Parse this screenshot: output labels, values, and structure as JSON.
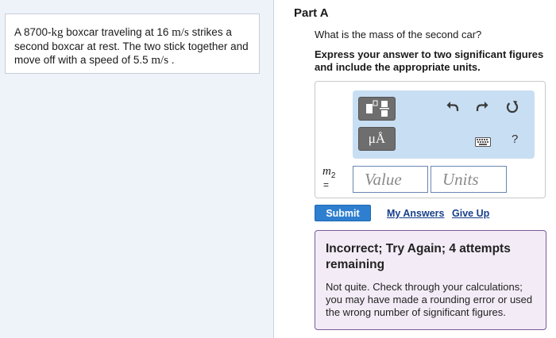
{
  "problem": {
    "text_1": "A 8700-",
    "mass_unit": "kg",
    "text_2": " boxcar traveling at 16 ",
    "speed_unit_1": "m/s",
    "text_3": " strikes a second boxcar at rest. The two stick together and move off with a speed of 5.5 ",
    "speed_unit_2": "m/s",
    "text_4": " ."
  },
  "part": {
    "title": "Part A",
    "question": "What is the mass of the second car?",
    "instruction": "Express your answer to two significant figures and include the appropriate units."
  },
  "toolbar": {
    "templates_icon": "templates-icon",
    "units_label": "μÅ",
    "undo_icon": "undo-icon",
    "redo_icon": "redo-icon",
    "reset_icon": "reset-icon",
    "keyboard_icon": "keyboard-icon",
    "help_label": "?"
  },
  "answer": {
    "variable": "m",
    "subscript": "2",
    "equals": "=",
    "value_placeholder": "Value",
    "units_placeholder": "Units"
  },
  "actions": {
    "submit_label": "Submit",
    "my_answers_label": "My Answers",
    "give_up_label": "Give Up"
  },
  "feedback": {
    "title": "Incorrect; Try Again; 4 attempts remaining",
    "text": "Not quite. Check through your calculations; you may have made a rounding error or used the wrong number of significant figures."
  },
  "colors": {
    "left_pane_bg": "#eef3fa",
    "toolbar_bg": "#c8def3",
    "submit_bg": "#2e7fcf",
    "feedback_bg": "#f3ecf7",
    "feedback_border": "#7c5a97",
    "link": "#173f8a"
  }
}
